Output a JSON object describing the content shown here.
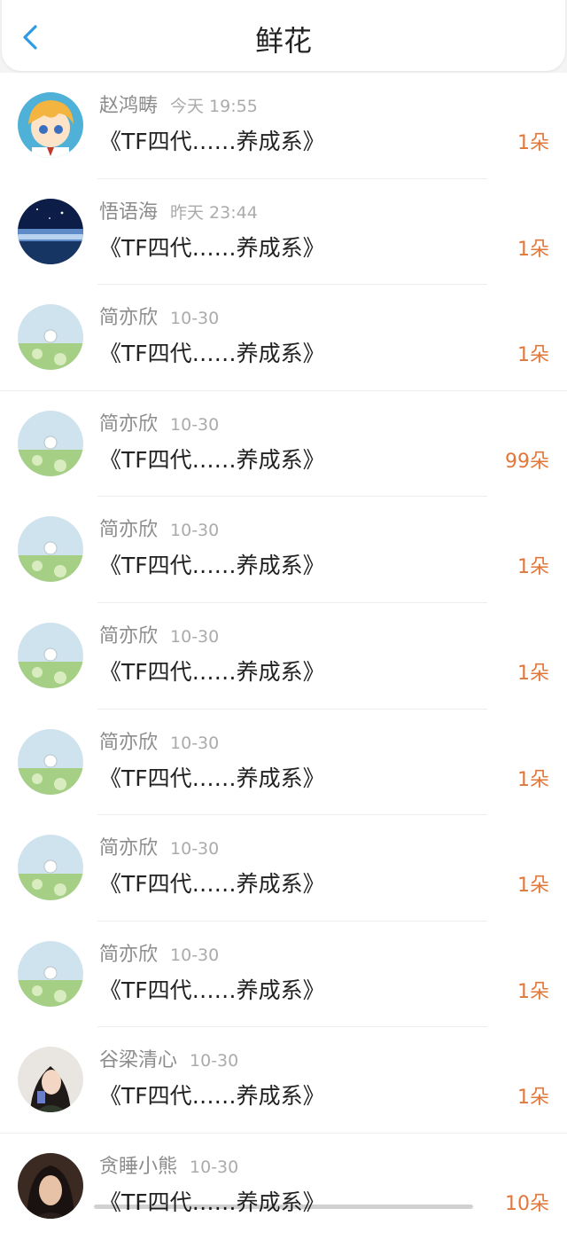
{
  "header": {
    "title": "鲜花",
    "back_icon": "chevron-left-icon",
    "accent_color": "#2f9be5"
  },
  "count_color": "#e2773a",
  "items": [
    {
      "name": "赵鸿畴",
      "time": "今天 19:55",
      "book": "《TF四代……养成系》",
      "count": "1朵",
      "avatar": "anime-boy-avatar"
    },
    {
      "name": "悟语海",
      "time": "昨天 23:44",
      "book": "《TF四代……养成系》",
      "count": "1朵",
      "avatar": "night-sky-avatar"
    },
    {
      "name": "简亦欣",
      "time": "10-30",
      "book": "《TF四代……养成系》",
      "count": "1朵",
      "avatar": "meadow-avatar"
    },
    {
      "name": "简亦欣",
      "time": "10-30",
      "book": "《TF四代……养成系》",
      "count": "99朵",
      "avatar": "meadow-avatar"
    },
    {
      "name": "简亦欣",
      "time": "10-30",
      "book": "《TF四代……养成系》",
      "count": "1朵",
      "avatar": "meadow-avatar"
    },
    {
      "name": "简亦欣",
      "time": "10-30",
      "book": "《TF四代……养成系》",
      "count": "1朵",
      "avatar": "meadow-avatar"
    },
    {
      "name": "简亦欣",
      "time": "10-30",
      "book": "《TF四代……养成系》",
      "count": "1朵",
      "avatar": "meadow-avatar"
    },
    {
      "name": "简亦欣",
      "time": "10-30",
      "book": "《TF四代……养成系》",
      "count": "1朵",
      "avatar": "meadow-avatar"
    },
    {
      "name": "简亦欣",
      "time": "10-30",
      "book": "《TF四代……养成系》",
      "count": "1朵",
      "avatar": "meadow-avatar"
    },
    {
      "name": "谷梁清心",
      "time": "10-30",
      "book": "《TF四代……养成系》",
      "count": "1朵",
      "avatar": "girl-photo-avatar"
    },
    {
      "name": "贪睡小熊",
      "time": "10-30",
      "book": "《TF四代……养成系》",
      "count": "10朵",
      "avatar": "girl-photo-avatar"
    }
  ]
}
